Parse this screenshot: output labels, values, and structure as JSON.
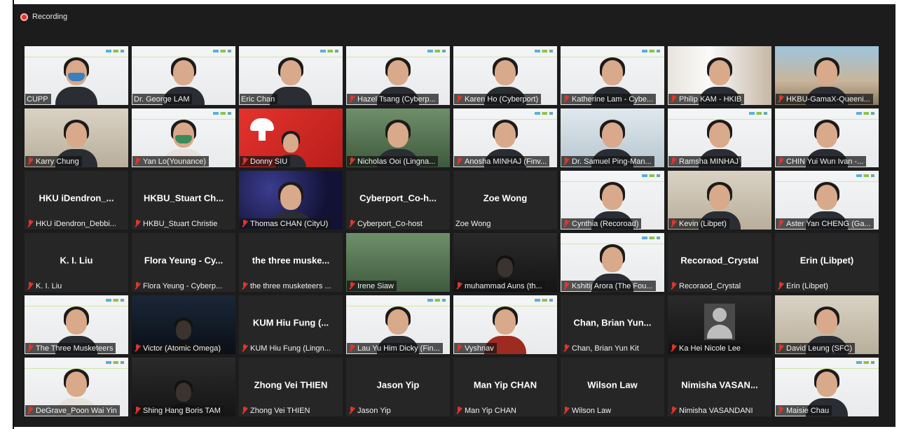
{
  "recording": {
    "label": "Recording"
  },
  "colors": {
    "active_speaker": "#d6e35a",
    "mic_muted": "#e0362c",
    "background": "#1c1c1c"
  },
  "participants": [
    {
      "name": "CUPP",
      "muted": false,
      "video": "slide",
      "active": false
    },
    {
      "name": "Dr. George LAM",
      "muted": false,
      "video": "slide",
      "active": true
    },
    {
      "name": "Eric Chan",
      "muted": false,
      "video": "slide",
      "active": false
    },
    {
      "name": "Hazel Tsang (Cyberp...",
      "muted": true,
      "video": "slide",
      "active": false
    },
    {
      "name": "Karen Ho (Cyberport)",
      "muted": true,
      "video": "slide",
      "active": false
    },
    {
      "name": "Katherine Lam - Cybe...",
      "muted": true,
      "video": "slide",
      "active": false
    },
    {
      "name": "Philip KAM - HKIB",
      "muted": true,
      "video": "window",
      "active": false
    },
    {
      "name": "HKBU-GamaX-Queeni...",
      "muted": true,
      "video": "building",
      "active": false
    },
    {
      "name": "Karry Chung",
      "muted": true,
      "video": "room",
      "active": false
    },
    {
      "name": "Yan Lo(Younance)",
      "muted": true,
      "video": "slide",
      "active": false
    },
    {
      "name": "Donny SIU",
      "muted": true,
      "video": "hackathon",
      "active": false
    },
    {
      "name": "Nicholas Ooi (Lingna...",
      "muted": true,
      "video": "garden",
      "active": false
    },
    {
      "name": "Anosha MINHAJ (Finv...",
      "muted": true,
      "video": "slide",
      "active": false
    },
    {
      "name": "Dr. Samuel Ping-Man...",
      "muted": true,
      "video": "portrait",
      "active": false
    },
    {
      "name": "Ramsha MINHAJ",
      "muted": true,
      "video": "slide",
      "active": false
    },
    {
      "name": "CHIN Yui Wun Ivan -...",
      "muted": true,
      "video": "slide",
      "active": false
    },
    {
      "name": "HKU iDendron_Debbi...",
      "display": "HKU iDendron_...",
      "muted": true,
      "video": "none",
      "active": false
    },
    {
      "name": "HKBU_Stuart Christie",
      "display": "HKBU_Stuart Ch...",
      "muted": true,
      "video": "none",
      "active": false
    },
    {
      "name": "Thomas CHAN (CityU)",
      "muted": true,
      "video": "stars",
      "active": false
    },
    {
      "name": "Cyberport_Co-host",
      "display": "Cyberport_Co-h...",
      "muted": true,
      "video": "none",
      "active": false
    },
    {
      "name": "Zoe Wong",
      "display": "Zoe Wong",
      "muted": false,
      "video": "none",
      "active": false
    },
    {
      "name": "Cynthia (Recoroad)",
      "muted": true,
      "video": "slide",
      "active": false
    },
    {
      "name": "Kevin (Libpet)",
      "muted": true,
      "video": "room",
      "active": false
    },
    {
      "name": "Aster Yan CHENG (Ga...",
      "muted": true,
      "video": "slide",
      "active": false
    },
    {
      "name": "K. I. Liu",
      "display": "K. I. Liu",
      "muted": true,
      "video": "none",
      "active": false
    },
    {
      "name": "Flora Yeung - Cyberp...",
      "display": "Flora Yeung - Cy...",
      "muted": true,
      "video": "none",
      "active": false
    },
    {
      "name": "the three musketeers ...",
      "display": "the three muske...",
      "muted": true,
      "video": "none",
      "active": false
    },
    {
      "name": "Irene Siaw",
      "muted": true,
      "video": "balcony",
      "active": false
    },
    {
      "name": "muhammad Auns (th...",
      "muted": true,
      "video": "dark",
      "active": false
    },
    {
      "name": "Kshitij Arora (The Fou...",
      "muted": true,
      "video": "slide",
      "active": false
    },
    {
      "name": "Recoraod_Crystal",
      "display": "Recoraod_Crystal",
      "muted": true,
      "video": "none",
      "active": false
    },
    {
      "name": "Erin (Libpet)",
      "display": "Erin (Libpet)",
      "muted": true,
      "video": "none",
      "active": false
    },
    {
      "name": "The Three Musketeers",
      "muted": true,
      "video": "slide",
      "active": false
    },
    {
      "name": "Victor (Atomic Omega)",
      "muted": true,
      "video": "night",
      "active": false
    },
    {
      "name": "KUM Hiu Fung (Lingn...",
      "display": "KUM Hiu Fung (...",
      "muted": true,
      "video": "none",
      "active": false
    },
    {
      "name": "Lau Yu Him Dicky (Fin...",
      "muted": true,
      "video": "slide",
      "active": false
    },
    {
      "name": "Vyshnav",
      "muted": true,
      "video": "slide",
      "active": false
    },
    {
      "name": "Chan, Brian Yun Kit",
      "display": "Chan, Brian Yun...",
      "muted": true,
      "video": "none",
      "active": false
    },
    {
      "name": "Ka Hei Nicole Lee",
      "muted": true,
      "video": "placeholder",
      "active": false
    },
    {
      "name": "David Leung (SFC)",
      "muted": true,
      "video": "room",
      "active": false
    },
    {
      "name": "DeGrave_Poon Wai Yin",
      "muted": true,
      "video": "slide",
      "active": false
    },
    {
      "name": "Shing Hang Boris TAM",
      "muted": true,
      "video": "dark",
      "active": false
    },
    {
      "name": "Zhong Vei THIEN",
      "display": "Zhong Vei THIEN",
      "muted": true,
      "video": "none",
      "active": false
    },
    {
      "name": "Jason Yip",
      "display": "Jason Yip",
      "muted": true,
      "video": "none",
      "active": false
    },
    {
      "name": "Man Yip CHAN",
      "display": "Man Yip CHAN",
      "muted": true,
      "video": "none",
      "active": false
    },
    {
      "name": "Wilson Law",
      "display": "Wilson Law",
      "muted": true,
      "video": "none",
      "active": false
    },
    {
      "name": "Nimisha VASANDANI",
      "display": "Nimisha VASAN...",
      "muted": true,
      "video": "none",
      "active": false
    },
    {
      "name": "Maisie Chau",
      "muted": true,
      "video": "slide",
      "active": false
    }
  ]
}
